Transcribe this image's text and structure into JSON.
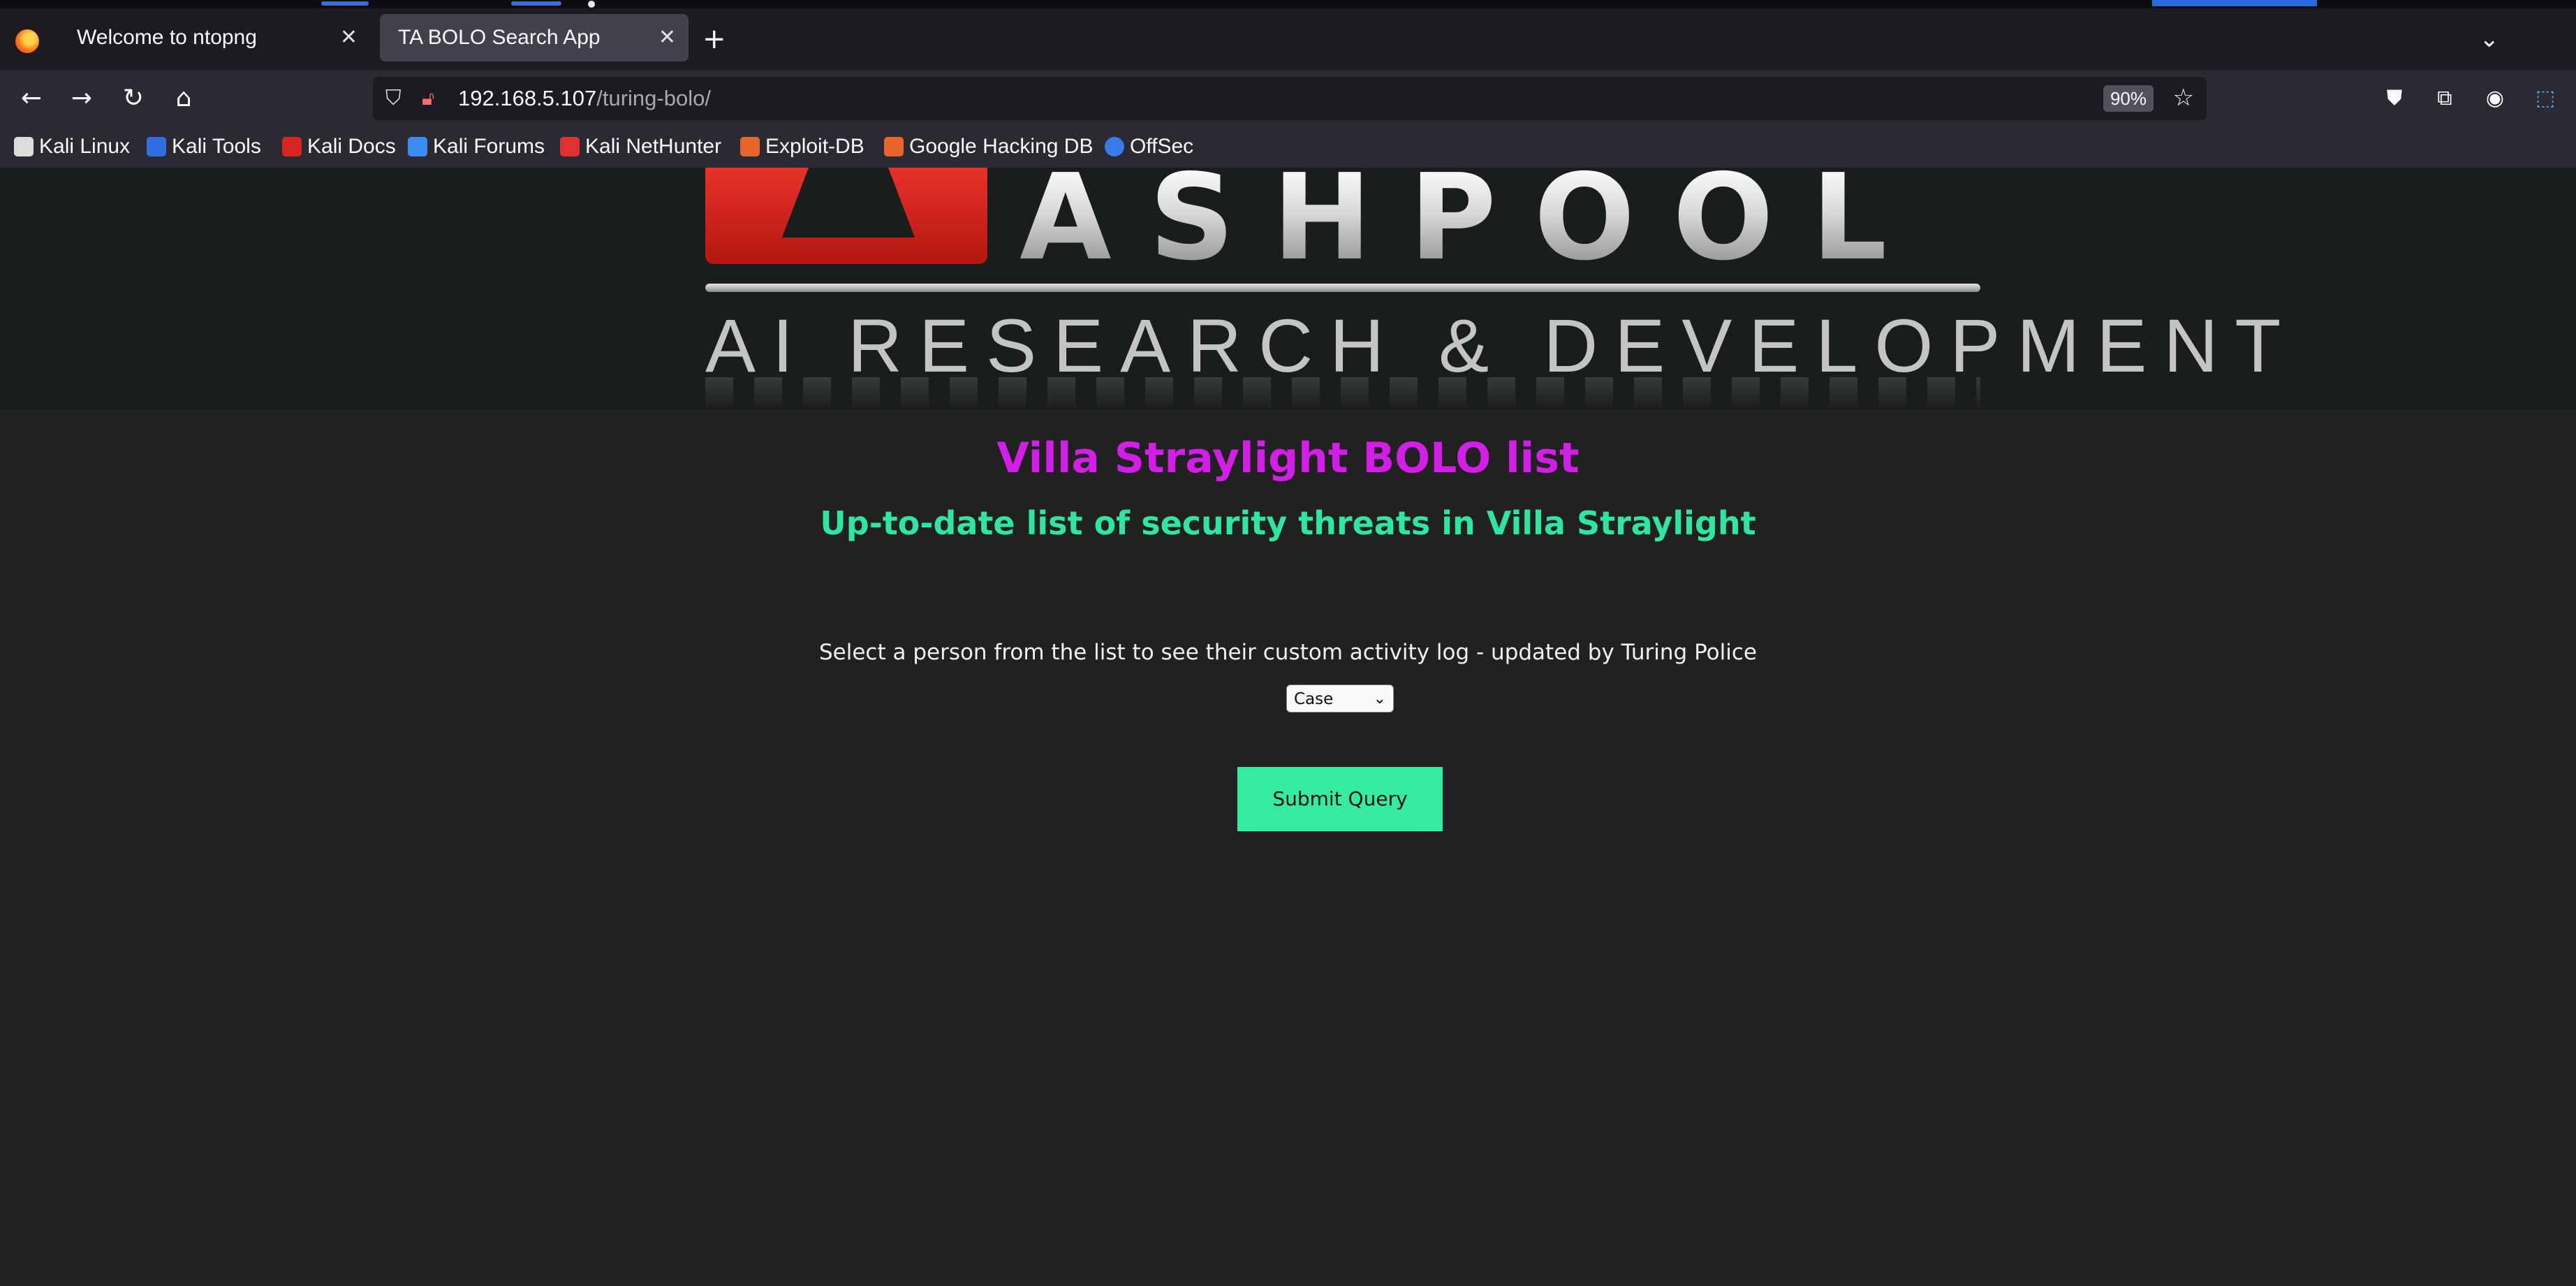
{
  "browser": {
    "tabs": [
      {
        "label": "Welcome to ntopng",
        "active": false
      },
      {
        "label": "TA BOLO Search App",
        "active": true
      }
    ],
    "new_tab_icon": "plus-icon",
    "url": {
      "host": "192.168.5.107",
      "path": "/turing-bolo/"
    },
    "zoom": "90%",
    "bookmarks": [
      {
        "label": "Kali Linux",
        "icon": "kali-dragon-icon",
        "color": "#ffffff"
      },
      {
        "label": "Kali Tools",
        "icon": "kali-tools-icon",
        "color": "#2f6fe0"
      },
      {
        "label": "Kali Docs",
        "icon": "kali-docs-icon",
        "color": "#d6261e"
      },
      {
        "label": "Kali Forums",
        "icon": "kali-forums-icon",
        "color": "#3b8cf0"
      },
      {
        "label": "Kali NetHunter",
        "icon": "nethunter-icon",
        "color": "#e03030"
      },
      {
        "label": "Exploit-DB",
        "icon": "exploit-db-icon",
        "color": "#e8652a"
      },
      {
        "label": "Google Hacking DB",
        "icon": "ghdb-icon",
        "color": "#e8652a"
      },
      {
        "label": "OffSec",
        "icon": "offsec-icon",
        "color": "#3a7be8"
      }
    ]
  },
  "logo": {
    "word": "ASHPOOL",
    "tagline": "AI RESEARCH  & DEVELOPMENT"
  },
  "main": {
    "title": "Villa Straylight BOLO list",
    "subtitle": "Up-to-date list of security threats in Villa Straylight",
    "instructions": "Select a person from the list to see their custom activity log - updated by Turing Police",
    "select": {
      "selected": "Case"
    },
    "submit_label": "Submit Query"
  },
  "colors": {
    "title": "#d21ee6",
    "subtitle": "#2ee6a0",
    "button": "#33ec9e",
    "page_bg": "#212121"
  }
}
